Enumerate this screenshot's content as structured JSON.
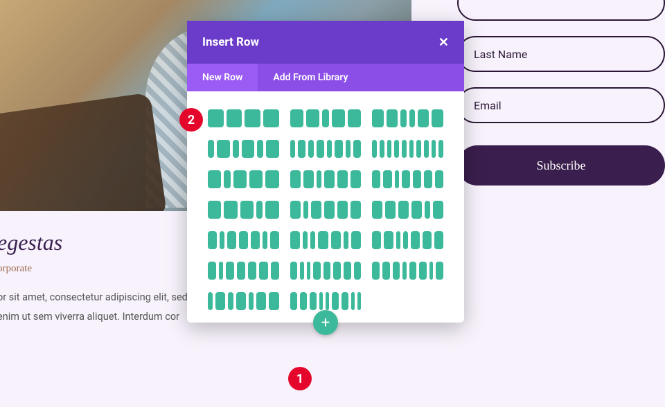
{
  "article": {
    "heading": "egestas",
    "subheading": "orporate",
    "body": "or sit amet, consectetur adipiscing elit, sed do   sed enim ut sem viverra aliquet. Interdum cor   d. Sem et…"
  },
  "form": {
    "fields": [
      {
        "placeholder": ""
      },
      {
        "placeholder": "Last Name"
      },
      {
        "placeholder": "Email"
      }
    ],
    "subscribe_label": "Subscribe"
  },
  "modal": {
    "title": "Insert Row",
    "tabs": {
      "new_row": "New Row",
      "add_library": "Add From Library"
    },
    "add_btn_glyph": "+"
  },
  "close_glyph": "✕",
  "callouts": {
    "one": "1",
    "two": "2"
  },
  "row_layouts": [
    [
      4,
      4,
      4,
      4
    ],
    [
      4,
      4,
      2,
      4,
      4
    ],
    [
      4,
      4,
      2,
      2,
      4,
      4
    ],
    [
      2,
      4,
      2,
      4,
      2,
      4
    ],
    [
      2,
      3,
      2,
      3,
      2,
      3,
      2,
      3
    ],
    [
      2,
      2,
      2,
      2,
      2,
      2,
      2,
      2,
      2,
      2
    ],
    [
      4,
      2,
      4,
      4,
      4
    ],
    [
      4,
      4,
      2,
      4,
      4,
      4
    ],
    [
      4,
      4,
      2,
      4,
      4,
      4,
      4
    ],
    [
      4,
      4,
      4,
      2,
      4
    ],
    [
      4,
      2,
      4,
      4,
      4,
      4
    ],
    [
      4,
      4,
      4,
      4,
      2,
      4
    ],
    [
      4,
      2,
      4,
      4,
      4,
      2,
      4
    ],
    [
      4,
      2,
      2,
      4,
      4,
      2,
      4
    ],
    [
      4,
      4,
      2,
      2,
      4,
      4,
      4
    ],
    [
      4,
      2,
      4,
      4,
      4,
      4,
      4
    ],
    [
      4,
      2,
      2,
      4,
      4,
      4,
      4,
      4
    ],
    [
      4,
      4,
      4,
      2,
      4,
      4,
      2,
      4
    ],
    [
      2,
      4,
      2,
      4,
      2,
      4,
      4
    ],
    [
      4,
      4,
      4,
      2,
      2,
      4,
      4,
      2,
      2
    ]
  ]
}
